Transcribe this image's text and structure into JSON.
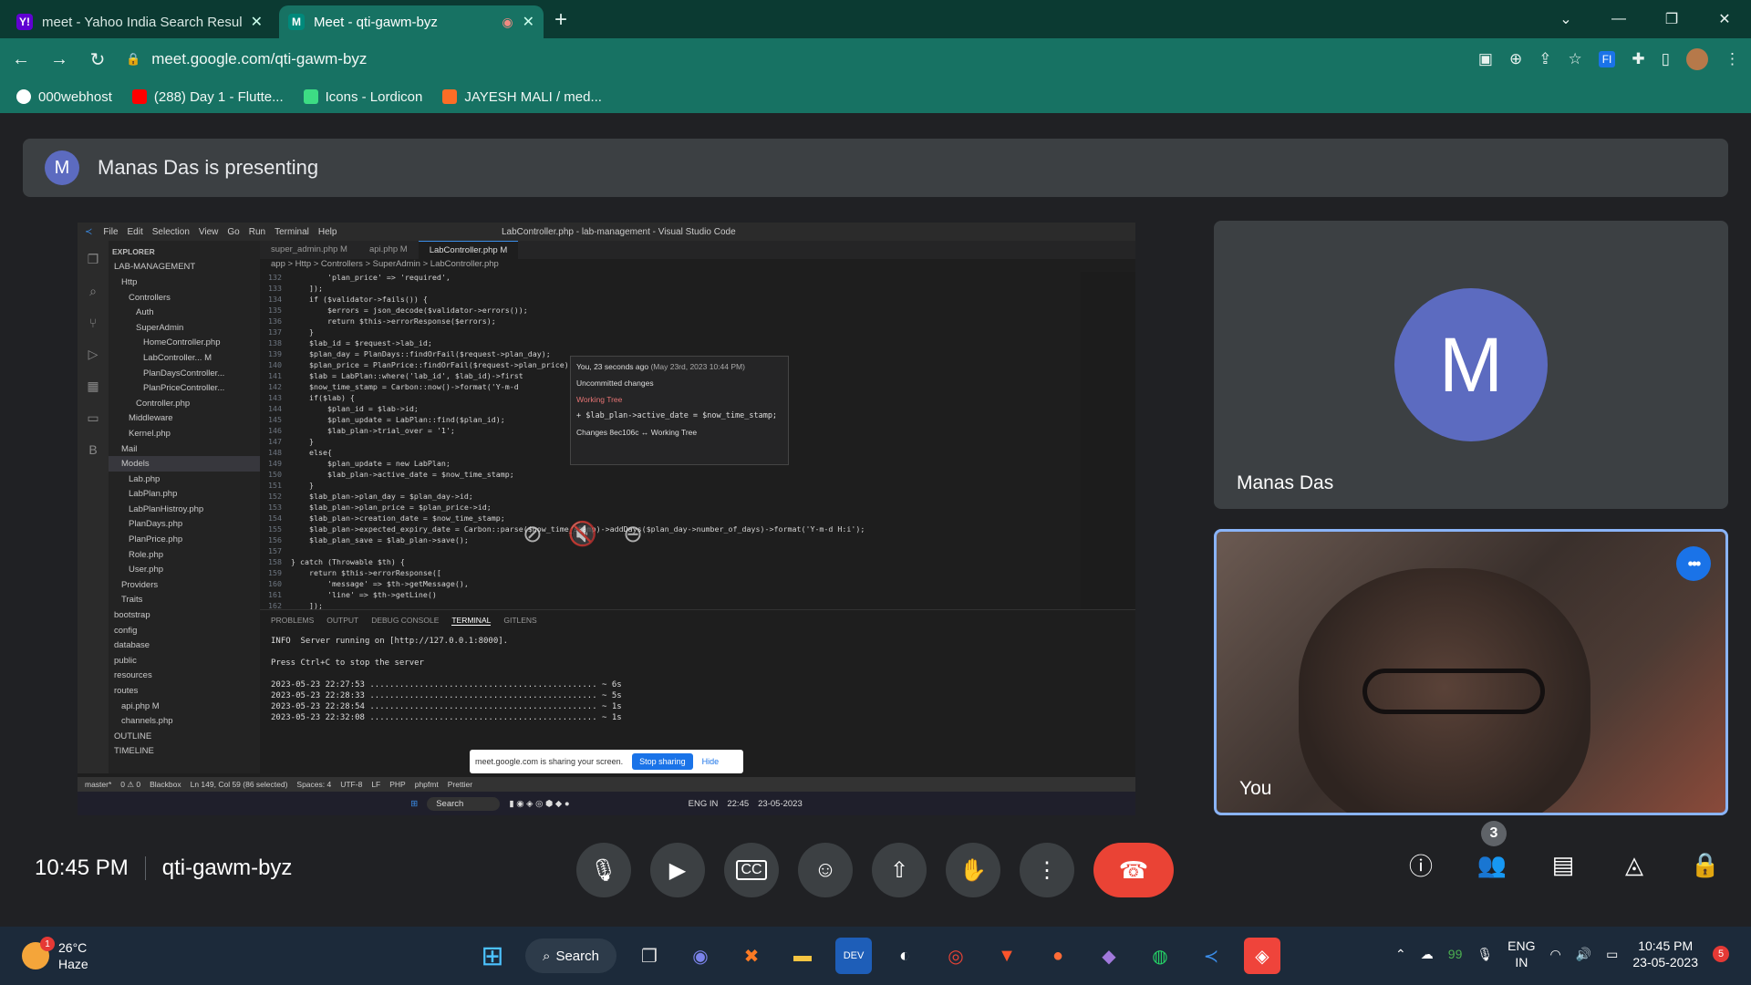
{
  "browser": {
    "tabs": [
      {
        "title": "meet - Yahoo India Search Result",
        "favicon": "Y!",
        "favicon_color": "#6001d2",
        "active": false
      },
      {
        "title": "Meet - qti-gawm-byz",
        "favicon": "M",
        "favicon_color": "#00897b",
        "active": true
      }
    ],
    "url": "meet.google.com/qti-gawm-byz",
    "bookmarks": [
      {
        "label": "000webhost",
        "color": "#ffffff"
      },
      {
        "label": "(288) Day 1 - Flutte...",
        "color": "#ff0000"
      },
      {
        "label": "Icons - Lordicon",
        "color": "#3ddc84"
      },
      {
        "label": "JAYESH MALI / med...",
        "color": "#fc6d26"
      }
    ],
    "accent": "#177263"
  },
  "meet": {
    "presenter_initial": "M",
    "presenting_text": "Manas Das is presenting",
    "presenter_name": "Manas Das",
    "self_name": "You",
    "time": "10:45 PM",
    "meeting_code": "qti-gawm-byz",
    "people_count": "3"
  },
  "shared_screen": {
    "menus": [
      "File",
      "Edit",
      "Selection",
      "View",
      "Go",
      "Run",
      "Terminal",
      "Help"
    ],
    "window_title": "LabController.php - lab-management - Visual Studio Code",
    "tabs": [
      "super_admin.php M",
      "api.php M",
      "LabController.php M"
    ],
    "breadcrumb": "app > Http > Controllers > SuperAdmin > LabController.php",
    "explorer_header": "EXPLORER",
    "explorer": [
      {
        "label": "LAB-MANAGEMENT",
        "indent": 0,
        "sel": false
      },
      {
        "label": "Http",
        "indent": 1,
        "sel": false
      },
      {
        "label": "Controllers",
        "indent": 2,
        "sel": false
      },
      {
        "label": "Auth",
        "indent": 3,
        "sel": false
      },
      {
        "label": "SuperAdmin",
        "indent": 3,
        "sel": false
      },
      {
        "label": "HomeController.php",
        "indent": 4,
        "sel": false
      },
      {
        "label": "LabController...  M",
        "indent": 4,
        "sel": false
      },
      {
        "label": "PlanDaysController...",
        "indent": 4,
        "sel": false
      },
      {
        "label": "PlanPriceController...",
        "indent": 4,
        "sel": false
      },
      {
        "label": "Controller.php",
        "indent": 3,
        "sel": false
      },
      {
        "label": "Middleware",
        "indent": 2,
        "sel": false
      },
      {
        "label": "Kernel.php",
        "indent": 2,
        "sel": false
      },
      {
        "label": "Mail",
        "indent": 1,
        "sel": false
      },
      {
        "label": "Models",
        "indent": 1,
        "sel": true
      },
      {
        "label": "Lab.php",
        "indent": 2,
        "sel": false
      },
      {
        "label": "LabPlan.php",
        "indent": 2,
        "sel": false
      },
      {
        "label": "LabPlanHistroy.php",
        "indent": 2,
        "sel": false
      },
      {
        "label": "PlanDays.php",
        "indent": 2,
        "sel": false
      },
      {
        "label": "PlanPrice.php",
        "indent": 2,
        "sel": false
      },
      {
        "label": "Role.php",
        "indent": 2,
        "sel": false
      },
      {
        "label": "User.php",
        "indent": 2,
        "sel": false
      },
      {
        "label": "Providers",
        "indent": 1,
        "sel": false
      },
      {
        "label": "Traits",
        "indent": 1,
        "sel": false
      },
      {
        "label": "bootstrap",
        "indent": 0,
        "sel": false
      },
      {
        "label": "config",
        "indent": 0,
        "sel": false
      },
      {
        "label": "database",
        "indent": 0,
        "sel": false
      },
      {
        "label": "public",
        "indent": 0,
        "sel": false
      },
      {
        "label": "resources",
        "indent": 0,
        "sel": false
      },
      {
        "label": "routes",
        "indent": 0,
        "sel": false
      },
      {
        "label": "api.php  M",
        "indent": 1,
        "sel": false
      },
      {
        "label": "channels.php",
        "indent": 1,
        "sel": false
      },
      {
        "label": "OUTLINE",
        "indent": 0,
        "sel": false
      },
      {
        "label": "TIMELINE",
        "indent": 0,
        "sel": false
      }
    ],
    "code": [
      {
        "n": "132",
        "t": "        'plan_price' => 'required',"
      },
      {
        "n": "133",
        "t": "    ]);"
      },
      {
        "n": "134",
        "t": "    if ($validator->fails()) {"
      },
      {
        "n": "135",
        "t": "        $errors = json_decode($validator->errors());"
      },
      {
        "n": "136",
        "t": "        return $this->errorResponse($errors);"
      },
      {
        "n": "137",
        "t": "    }"
      },
      {
        "n": "138",
        "t": "    $lab_id = $request->lab_id;"
      },
      {
        "n": "139",
        "t": "    $plan_day = PlanDays::findOrFail($request->plan_day);"
      },
      {
        "n": "140",
        "t": "    $plan_price = PlanPrice::findOrFail($request->plan_price);"
      },
      {
        "n": "141",
        "t": "    $lab = LabPlan::where('lab_id', $lab_id)->first"
      },
      {
        "n": "142",
        "t": "    $now_time_stamp = Carbon::now()->format('Y-m-d"
      },
      {
        "n": "143",
        "t": "    if($lab) {"
      },
      {
        "n": "144",
        "t": "        $plan_id = $lab->id;"
      },
      {
        "n": "145",
        "t": "        $plan_update = LabPlan::find($plan_id);"
      },
      {
        "n": "146",
        "t": "        $lab_plan->trial_over = '1';"
      },
      {
        "n": "147",
        "t": "    }"
      },
      {
        "n": "148",
        "t": "    else{"
      },
      {
        "n": "149",
        "t": "        $plan_update = new LabPlan;"
      },
      {
        "n": "150",
        "t": "        $lab_plan->active_date = $now_time_stamp;"
      },
      {
        "n": "151",
        "t": "    }"
      },
      {
        "n": "152",
        "t": "    $lab_plan->plan_day = $plan_day->id;"
      },
      {
        "n": "153",
        "t": "    $lab_plan->plan_price = $plan_price->id;"
      },
      {
        "n": "154",
        "t": "    $lab_plan->creation_date = $now_time_stamp;"
      },
      {
        "n": "155",
        "t": "    $lab_plan->expected_expiry_date = Carbon::parse($now_time_stamp)->addDays($plan_day->number_of_days)->format('Y-m-d H:i');"
      },
      {
        "n": "156",
        "t": "    $lab_plan_save = $lab_plan->save();"
      },
      {
        "n": "157",
        "t": ""
      },
      {
        "n": "158",
        "t": "} catch (Throwable $th) {"
      },
      {
        "n": "159",
        "t": "    return $this->errorResponse(["
      },
      {
        "n": "160",
        "t": "        'message' => $th->getMessage(),"
      },
      {
        "n": "161",
        "t": "        'line' => $th->getLine()"
      },
      {
        "n": "162",
        "t": "    ]);"
      },
      {
        "n": "163",
        "t": "}"
      }
    ],
    "hover": {
      "author": "You, 23 seconds ago",
      "date": "(May 23rd, 2023 10:44 PM)",
      "message": "Uncommitted changes",
      "tree": "Working Tree",
      "diff": "+ $lab_plan->active_date =  $now_time_stamp;",
      "changes": "Changes  8ec106c ↔ Working Tree"
    },
    "panel_tabs": [
      "PROBLEMS",
      "OUTPUT",
      "DEBUG CONSOLE",
      "TERMINAL",
      "GITLENS"
    ],
    "terminal": [
      "INFO  Server running on [http://127.0.0.1:8000].",
      "",
      "Press Ctrl+C to stop the server",
      "",
      "2023-05-23 22:27:53 .............................................. ~ 6s",
      "2023-05-23 22:28:33 .............................................. ~ 5s",
      "2023-05-23 22:28:54 .............................................. ~ 1s",
      "2023-05-23 22:32:08 .............................................. ~ 1s"
    ],
    "status": [
      "master*",
      "0 ⚠ 0",
      "Blackbox",
      "Ln 149, Col 59 (86 selected)",
      "Spaces: 4",
      "UTF-8",
      "LF",
      "PHP",
      "phpfmt",
      "Prettier"
    ],
    "share_notice": "meet.google.com is sharing your screen.",
    "stop_sharing": "Stop sharing",
    "hide": "Hide",
    "taskbar_search": "Search",
    "taskbar_lang": "ENG IN",
    "taskbar_time": "22:45",
    "taskbar_date": "23-05-2023"
  },
  "taskbar": {
    "temp": "26°C",
    "condition": "Haze",
    "weather_badge": "1",
    "search": "Search",
    "tray_count": "99",
    "lang_top": "ENG",
    "lang_bottom": "IN",
    "time": "10:45 PM",
    "date": "23-05-2023",
    "notif": "5"
  }
}
